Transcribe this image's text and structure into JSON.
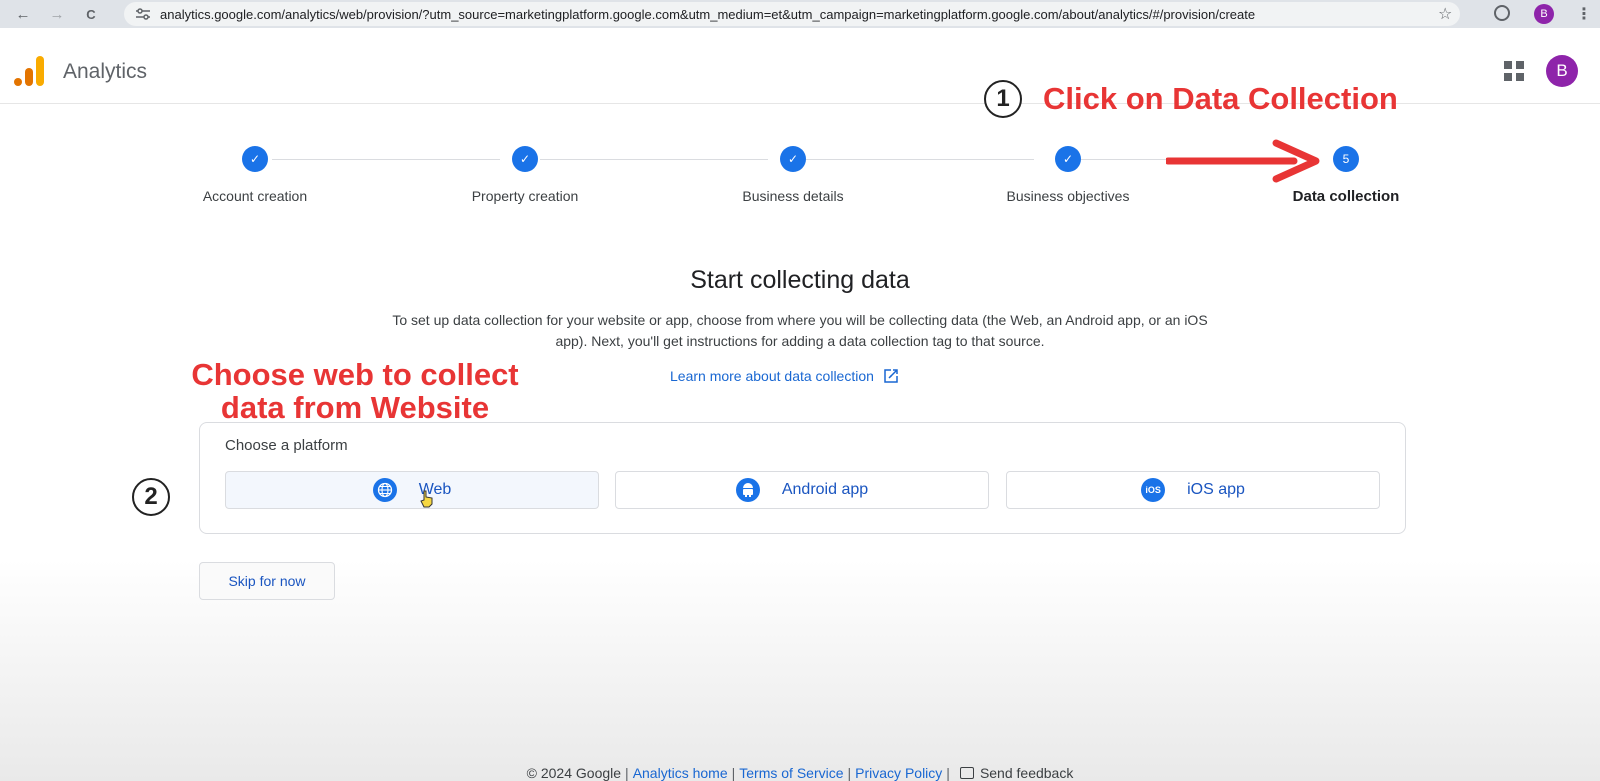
{
  "browser": {
    "back": "←",
    "forward": "→",
    "reload": "C",
    "url": "analytics.google.com/analytics/web/provision/?utm_source=marketingplatform.google.com&utm_medium=et&utm_campaign=marketingplatform.google.com/about/analytics/#/provision/create",
    "star": "☆",
    "profile": "B",
    "menu": "⋮"
  },
  "header": {
    "title": "Analytics",
    "avatar": "B"
  },
  "stepper": {
    "steps": [
      {
        "label": "Account creation",
        "mark": "✓",
        "state": "done"
      },
      {
        "label": "Property creation",
        "mark": "✓",
        "state": "done"
      },
      {
        "label": "Business details",
        "mark": "✓",
        "state": "done"
      },
      {
        "label": "Business objectives",
        "mark": "✓",
        "state": "done"
      },
      {
        "label": "Data collection",
        "mark": "5",
        "state": "active"
      }
    ]
  },
  "annotations": {
    "one": {
      "number": "1",
      "text": "Click on Data Collection"
    },
    "two": {
      "number": "2",
      "line1": "Choose web to collect",
      "line2": "data from Website"
    },
    "accent": "#e83535"
  },
  "main": {
    "title": "Start collecting data",
    "description": "To set up data collection for your website or app, choose from where you will be collecting data (the Web, an Android app, or an iOS app). Next, you'll get instructions for adding a data collection tag to that source.",
    "learn_more": "Learn more about data collection",
    "platform": {
      "title": "Choose a platform",
      "options": [
        {
          "label": "Web",
          "icon": "globe-icon"
        },
        {
          "label": "Android app",
          "icon": "android-icon"
        },
        {
          "label": "iOS app",
          "icon": "ios-icon",
          "icon_text": "iOS"
        }
      ]
    },
    "skip": "Skip for now"
  },
  "footer": {
    "copyright": "© 2024 Google",
    "links": [
      "Analytics home",
      "Terms of Service",
      "Privacy Policy"
    ],
    "feedback": "Send feedback"
  },
  "colors": {
    "primary": "#1a73e8",
    "link": "#1967d2",
    "avatar": "#8e24aa"
  }
}
